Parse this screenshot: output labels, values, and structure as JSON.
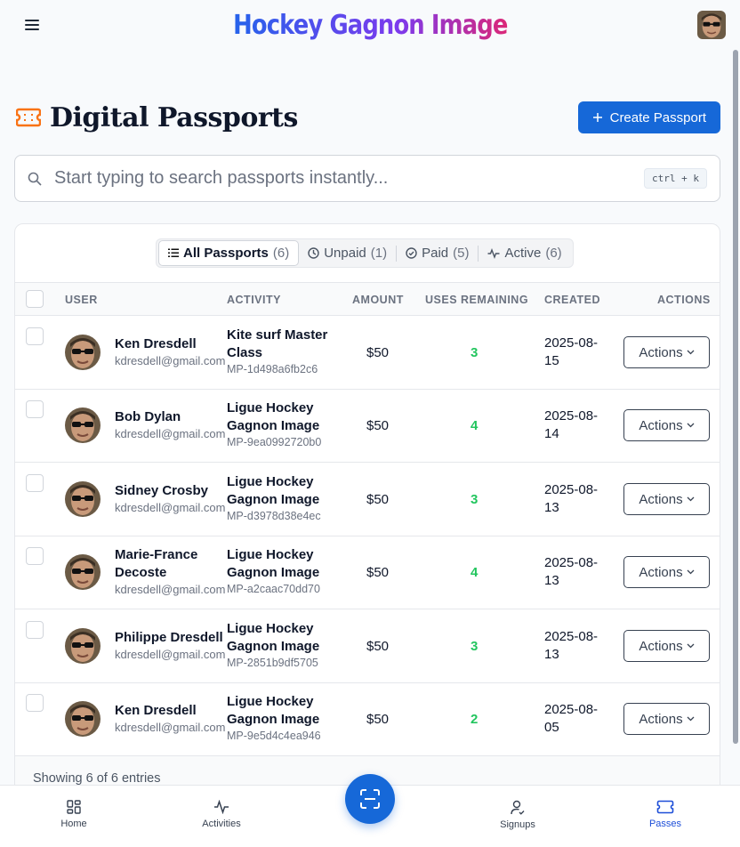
{
  "app": {
    "title": "Hockey Gagnon Image"
  },
  "page": {
    "title": "Digital Passports",
    "create_label": "Create Passport"
  },
  "search": {
    "placeholder": "Start typing to search passports instantly...",
    "shortcut": "ctrl + k"
  },
  "filters": [
    {
      "label": "All Passports",
      "count": "(6)",
      "icon": "list-icon",
      "active": true
    },
    {
      "label": "Unpaid",
      "count": "(1)",
      "icon": "clock-icon",
      "active": false
    },
    {
      "label": "Paid",
      "count": "(5)",
      "icon": "check-circle-icon",
      "active": false
    },
    {
      "label": "Active",
      "count": "(6)",
      "icon": "activity-icon",
      "active": false
    }
  ],
  "table": {
    "headers": {
      "user": "USER",
      "activity": "ACTIVITY",
      "amount": "AMOUNT",
      "uses": "USES REMAINING",
      "created": "CREATED",
      "actions": "ACTIONS"
    },
    "rows": [
      {
        "name": "Ken Dresdell",
        "email": "kdresdell@gmail.com",
        "activity": "Kite surf Master Class",
        "code": "MP-1d498a6fb2c6",
        "amount": "$50",
        "uses": "3",
        "created": "2025-08-15",
        "action": "Actions"
      },
      {
        "name": "Bob Dylan",
        "email": "kdresdell@gmail.com",
        "activity": "Ligue Hockey Gagnon Image",
        "code": "MP-9ea0992720b0",
        "amount": "$50",
        "uses": "4",
        "created": "2025-08-14",
        "action": "Actions"
      },
      {
        "name": "Sidney Crosby",
        "email": "kdresdell@gmail.com",
        "activity": "Ligue Hockey Gagnon Image",
        "code": "MP-d3978d38e4ec",
        "amount": "$50",
        "uses": "3",
        "created": "2025-08-13",
        "action": "Actions"
      },
      {
        "name": "Marie-France Decoste",
        "email": "kdresdell@gmail.com",
        "activity": "Ligue Hockey Gagnon Image",
        "code": "MP-a2caac70dd70",
        "amount": "$50",
        "uses": "4",
        "created": "2025-08-13",
        "action": "Actions"
      },
      {
        "name": "Philippe Dresdell",
        "email": "kdresdell@gmail.com",
        "activity": "Ligue Hockey Gagnon Image",
        "code": "MP-2851b9df5705",
        "amount": "$50",
        "uses": "3",
        "created": "2025-08-13",
        "action": "Actions"
      },
      {
        "name": "Ken Dresdell",
        "email": "kdresdell@gmail.com",
        "activity": "Ligue Hockey Gagnon Image",
        "code": "MP-9e5d4c4ea946",
        "amount": "$50",
        "uses": "2",
        "created": "2025-08-05",
        "action": "Actions"
      }
    ],
    "footer": "Showing 6 of 6 entries"
  },
  "nav": [
    {
      "label": "Home",
      "icon": "grid-icon"
    },
    {
      "label": "Activities",
      "icon": "activity-icon"
    },
    {
      "label": "Signups",
      "icon": "user-check-icon"
    },
    {
      "label": "Passes",
      "icon": "ticket-icon",
      "active": true
    }
  ],
  "colors": {
    "primary": "#1668d8",
    "success": "#22c55e",
    "brand_orange": "#f97316"
  }
}
